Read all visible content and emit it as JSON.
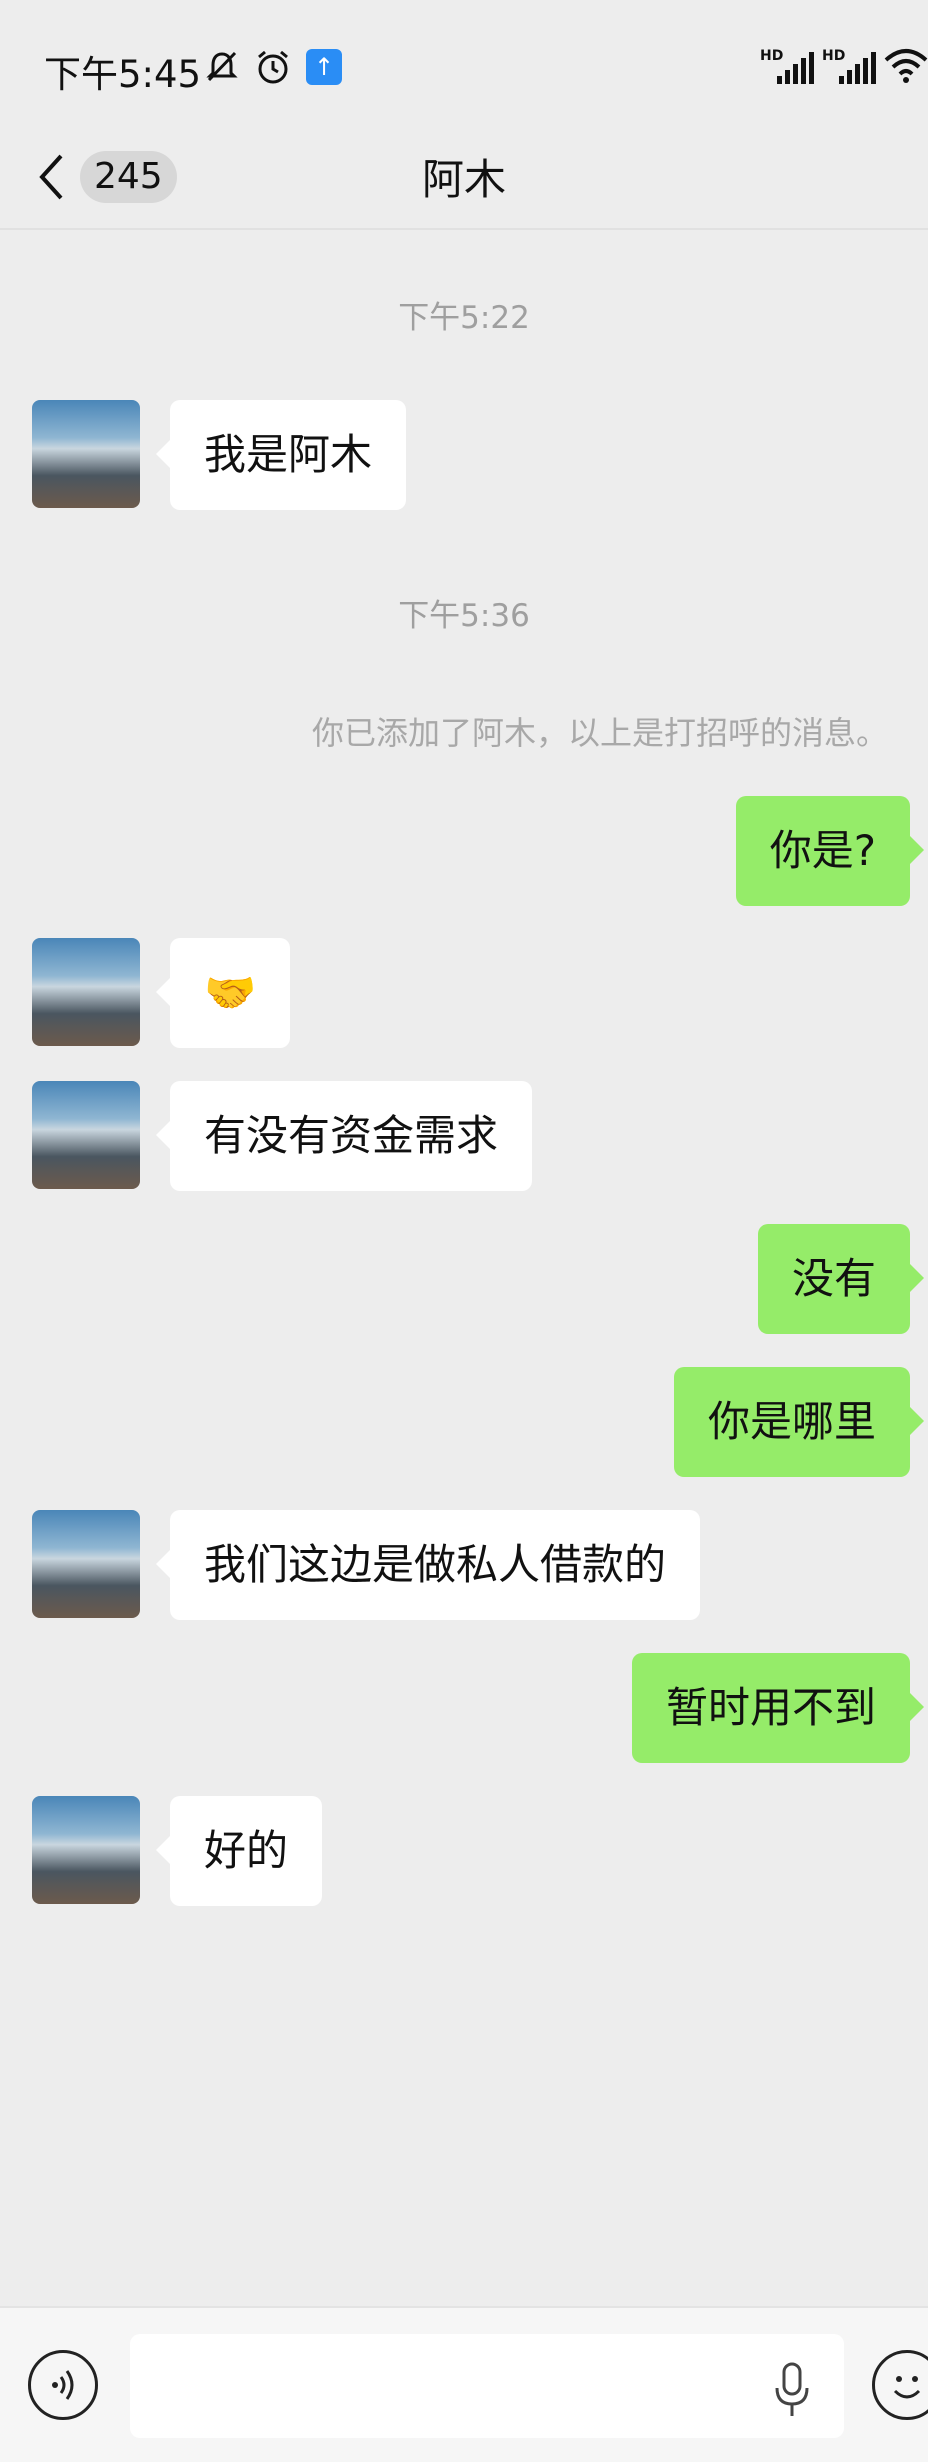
{
  "status_bar": {
    "time": "下午5:45",
    "icons": [
      "mute-bell-icon",
      "alarm-icon",
      "upload-icon",
      "signal-hd-1-icon",
      "signal-hd-2-icon",
      "wifi-icon"
    ]
  },
  "header": {
    "back_count": "245",
    "title": "阿木"
  },
  "chat": {
    "timestamp_1": "下午5:22",
    "timestamp_2": "下午5:36",
    "system_note": "你已添加了阿木，以上是打招呼的消息。",
    "messages": [
      {
        "from": "contact",
        "text": "我是阿木"
      },
      {
        "from": "me",
        "text": "你是?"
      },
      {
        "from": "contact",
        "text": "🤝"
      },
      {
        "from": "contact",
        "text": "有没有资金需求"
      },
      {
        "from": "me",
        "text": "没有"
      },
      {
        "from": "me",
        "text": "你是哪里"
      },
      {
        "from": "contact",
        "text": "我们这边是做私人借款的"
      },
      {
        "from": "me",
        "text": "暂时用不到"
      },
      {
        "from": "contact",
        "text": "好的"
      }
    ]
  },
  "input_bar": {
    "placeholder": ""
  },
  "colors": {
    "background": "#ededed",
    "incoming_bubble": "#ffffff",
    "outgoing_bubble": "#95ec69",
    "timestamp_text": "#9f9f9f"
  }
}
